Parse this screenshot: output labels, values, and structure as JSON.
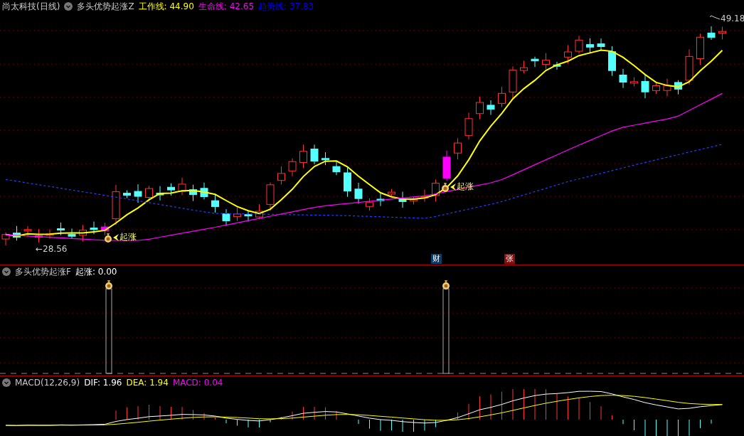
{
  "main_panel": {
    "title": "尚太科技(日线)",
    "indicator": "多头优势起涨Z",
    "readings": [
      {
        "text": "工作线: 44.90",
        "color": "#ffff00"
      },
      {
        "text": "生命线: 42.65",
        "color": "#ff00ff"
      },
      {
        "text": "趋势线: 37.83",
        "color": "#0000ff"
      }
    ],
    "high_label": "49.18",
    "low_label": "←28.56",
    "signals": [
      {
        "text": "起涨"
      },
      {
        "text": "起涨"
      }
    ],
    "event_tags": [
      {
        "text": "财",
        "color": "#0b3d6b"
      },
      {
        "text": "张",
        "color": "#8a0c0c"
      }
    ]
  },
  "signal_panel": {
    "indicator": "多头优势起涨F",
    "readings": [
      {
        "text": "起涨: 0.00",
        "color": "#ffffff"
      }
    ]
  },
  "macd_panel": {
    "indicator": "MACD(12,26,9)",
    "readings": [
      {
        "text": "DIF: 1.96",
        "color": "#ffffff"
      },
      {
        "text": "DEA: 1.94",
        "color": "#ffff00"
      },
      {
        "text": "MACD: 0.04",
        "color": "#ff00ff"
      }
    ]
  }
}
